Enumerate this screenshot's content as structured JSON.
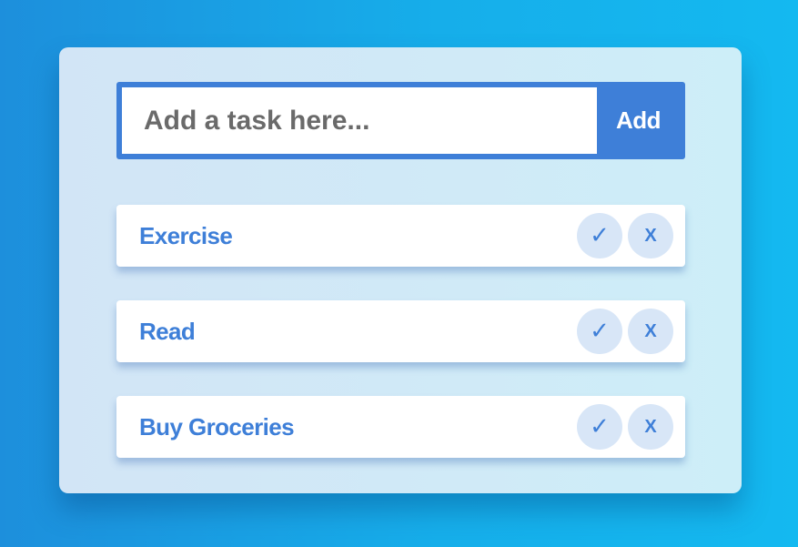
{
  "task_input": {
    "placeholder": "Add a task here...",
    "value": ""
  },
  "add_button": {
    "label": "Add"
  },
  "tasks": [
    {
      "label": "Exercise",
      "complete_icon": "✓",
      "delete_icon": "X"
    },
    {
      "label": "Read",
      "complete_icon": "✓",
      "delete_icon": "X"
    },
    {
      "label": "Buy Groceries",
      "complete_icon": "✓",
      "delete_icon": "X"
    }
  ],
  "colors": {
    "accent": "#3e7fd8",
    "background_left": "#1d8fdc",
    "background_right": "#14b9f0",
    "card": "#d0eaf7",
    "button_circle": "#d8e6f7"
  },
  "icons": {
    "complete": "checkmark-icon",
    "delete": "x-icon"
  }
}
